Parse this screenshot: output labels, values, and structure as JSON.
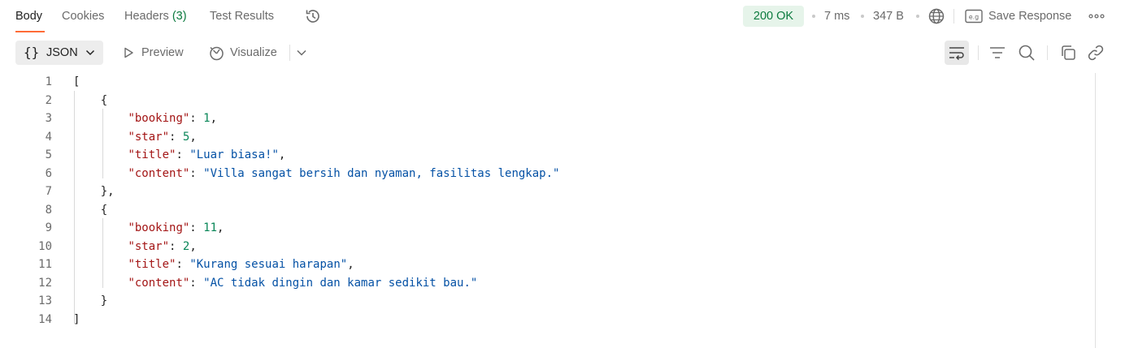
{
  "tabs": [
    {
      "label": "Body",
      "active": true
    },
    {
      "label": "Cookies"
    },
    {
      "label": "Headers",
      "count": "(3)"
    },
    {
      "label": "Test Results"
    }
  ],
  "response_meta": {
    "status": "200 OK",
    "time": "7 ms",
    "size": "347 B",
    "save_label": "Save Response"
  },
  "toolbar": {
    "format_braces": "{}",
    "format_label": "JSON",
    "preview_label": "Preview",
    "visualize_label": "Visualize"
  },
  "body_lines": [
    {
      "no": "1",
      "indent": 0,
      "tokens": [
        {
          "t": "p",
          "v": "["
        }
      ]
    },
    {
      "no": "2",
      "indent": 1,
      "tokens": [
        {
          "t": "p",
          "v": "{"
        }
      ]
    },
    {
      "no": "3",
      "indent": 2,
      "tokens": [
        {
          "t": "k",
          "v": "\"booking\""
        },
        {
          "t": "p",
          "v": ": "
        },
        {
          "t": "n",
          "v": "1"
        },
        {
          "t": "p",
          "v": ","
        }
      ]
    },
    {
      "no": "4",
      "indent": 2,
      "tokens": [
        {
          "t": "k",
          "v": "\"star\""
        },
        {
          "t": "p",
          "v": ": "
        },
        {
          "t": "n",
          "v": "5"
        },
        {
          "t": "p",
          "v": ","
        }
      ]
    },
    {
      "no": "5",
      "indent": 2,
      "tokens": [
        {
          "t": "k",
          "v": "\"title\""
        },
        {
          "t": "p",
          "v": ": "
        },
        {
          "t": "s",
          "v": "\"Luar biasa!\""
        },
        {
          "t": "p",
          "v": ","
        }
      ]
    },
    {
      "no": "6",
      "indent": 2,
      "tokens": [
        {
          "t": "k",
          "v": "\"content\""
        },
        {
          "t": "p",
          "v": ": "
        },
        {
          "t": "s",
          "v": "\"Villa sangat bersih dan nyaman, fasilitas lengkap.\""
        }
      ]
    },
    {
      "no": "7",
      "indent": 1,
      "tokens": [
        {
          "t": "p",
          "v": "},"
        }
      ]
    },
    {
      "no": "8",
      "indent": 1,
      "tokens": [
        {
          "t": "p",
          "v": "{"
        }
      ]
    },
    {
      "no": "9",
      "indent": 2,
      "tokens": [
        {
          "t": "k",
          "v": "\"booking\""
        },
        {
          "t": "p",
          "v": ": "
        },
        {
          "t": "n",
          "v": "11"
        },
        {
          "t": "p",
          "v": ","
        }
      ]
    },
    {
      "no": "10",
      "indent": 2,
      "tokens": [
        {
          "t": "k",
          "v": "\"star\""
        },
        {
          "t": "p",
          "v": ": "
        },
        {
          "t": "n",
          "v": "2"
        },
        {
          "t": "p",
          "v": ","
        }
      ]
    },
    {
      "no": "11",
      "indent": 2,
      "tokens": [
        {
          "t": "k",
          "v": "\"title\""
        },
        {
          "t": "p",
          "v": ": "
        },
        {
          "t": "s",
          "v": "\"Kurang sesuai harapan\""
        },
        {
          "t": "p",
          "v": ","
        }
      ]
    },
    {
      "no": "12",
      "indent": 2,
      "tokens": [
        {
          "t": "k",
          "v": "\"content\""
        },
        {
          "t": "p",
          "v": ": "
        },
        {
          "t": "s",
          "v": "\"AC tidak dingin dan kamar sedikit bau.\""
        }
      ]
    },
    {
      "no": "13",
      "indent": 1,
      "tokens": [
        {
          "t": "p",
          "v": "}"
        }
      ]
    },
    {
      "no": "14",
      "indent": 0,
      "tokens": [
        {
          "t": "p",
          "v": "]"
        }
      ]
    }
  ],
  "icons": {
    "history": "history-icon",
    "globe": "globe-icon",
    "save": "save-example-icon",
    "more": "more-options-icon",
    "preview": "play-icon",
    "visualize": "visualize-icon",
    "dropdown": "chevron-down-icon",
    "wrap": "wrap-lines-icon",
    "filter": "filter-icon",
    "search": "search-icon",
    "copy": "copy-icon",
    "link": "link-icon"
  },
  "colors": {
    "accent": "#ff6c37",
    "status_bg": "#e6f4ea",
    "status_fg": "#0b7a3e",
    "json_key": "#a31515",
    "json_number": "#098658",
    "json_string": "#0451a5"
  }
}
